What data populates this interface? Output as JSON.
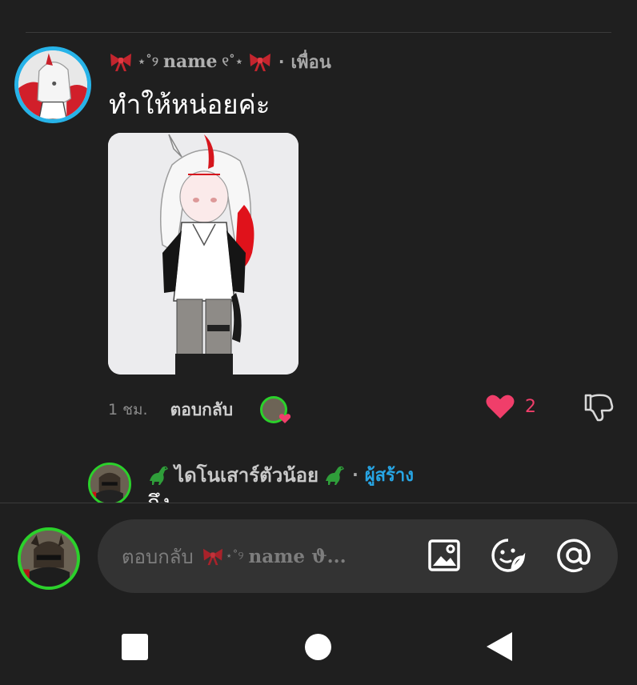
{
  "comment": {
    "username": "name",
    "username_decor_left": "⋆˚୨",
    "username_decor_right": "୧˚⋆",
    "relation_label": "เพื่อน",
    "text": "ทำให้หน่อยค่ะ",
    "time": "1 ชม.",
    "reply_label": "ตอบกลับ",
    "like_count": "2",
    "liked": true
  },
  "reply": {
    "username": "ไดโนเสาร์ตัวน้อย",
    "role_label": "ผู้สร้าง",
    "text_partial": "ถึง"
  },
  "input": {
    "placeholder_prefix": "ตอบกลับ",
    "placeholder_decor": "⋆˚୨",
    "placeholder_name": "name ϑ..."
  },
  "colors": {
    "background": "#1f1f1f",
    "like_red": "#f03e6a",
    "creator_blue": "#27a6e6",
    "avatar_ring_blue": "#27b3e8",
    "avatar_ring_green": "#2bd12b"
  },
  "icons": [
    "bow-icon",
    "heart-icon",
    "dislike-icon",
    "dino-icon",
    "image-icon",
    "sticker-icon",
    "mention-icon"
  ]
}
